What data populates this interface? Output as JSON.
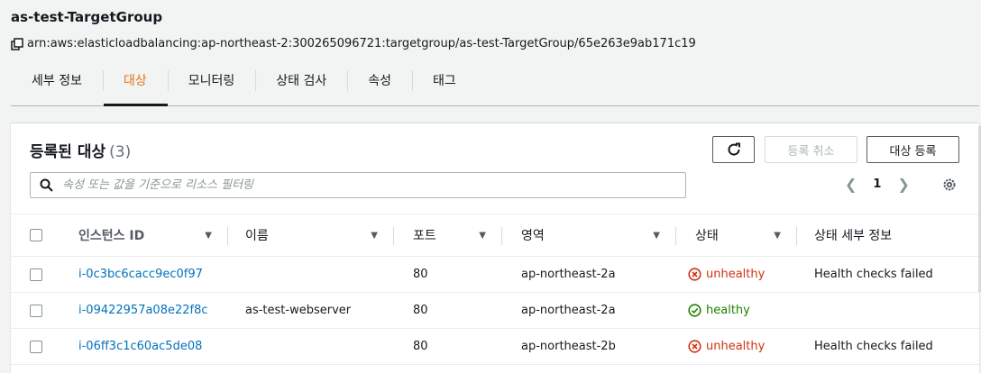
{
  "header": {
    "title": "as-test-TargetGroup",
    "arn": "arn:aws:elasticloadbalancing:ap-northeast-2:300265096721:targetgroup/as-test-TargetGroup/65e263e9ab171c19"
  },
  "tabs": [
    {
      "label": "세부 정보",
      "active": false
    },
    {
      "label": "대상",
      "active": true
    },
    {
      "label": "모니터링",
      "active": false
    },
    {
      "label": "상태 검사",
      "active": false
    },
    {
      "label": "속성",
      "active": false
    },
    {
      "label": "태그",
      "active": false
    }
  ],
  "panel": {
    "title": "등록된 대상",
    "count": "(3)",
    "deregister_label": "등록 취소",
    "register_label": "대상 등록",
    "search_placeholder": "속성 또는 값을 기준으로 리소스 필터링",
    "page": "1"
  },
  "table": {
    "columns": [
      "인스턴스 ID",
      "이름",
      "포트",
      "영역",
      "상태",
      "상태 세부 정보"
    ],
    "rows": [
      {
        "instance_id": "i-0c3bc6cacc9ec0f97",
        "name": "",
        "port": "80",
        "zone": "ap-northeast-2a",
        "status": "unhealthy",
        "details": "Health checks failed"
      },
      {
        "instance_id": "i-09422957a08e22f8c",
        "name": "as-test-webserver",
        "port": "80",
        "zone": "ap-northeast-2a",
        "status": "healthy",
        "details": ""
      },
      {
        "instance_id": "i-06ff3c1c60ac5de08",
        "name": "",
        "port": "80",
        "zone": "ap-northeast-2b",
        "status": "unhealthy",
        "details": "Health checks failed"
      }
    ]
  },
  "colors": {
    "accent": "#ec7211",
    "link": "#0073bb",
    "unhealthy": "#d13212",
    "healthy": "#1d8102"
  },
  "icons": {
    "copy": "copy-icon",
    "refresh": "refresh-icon",
    "search": "search-icon",
    "settings": "gear-icon",
    "sort": "caret-down-icon",
    "unhealthy": "x-circle-icon",
    "healthy": "check-circle-icon"
  }
}
